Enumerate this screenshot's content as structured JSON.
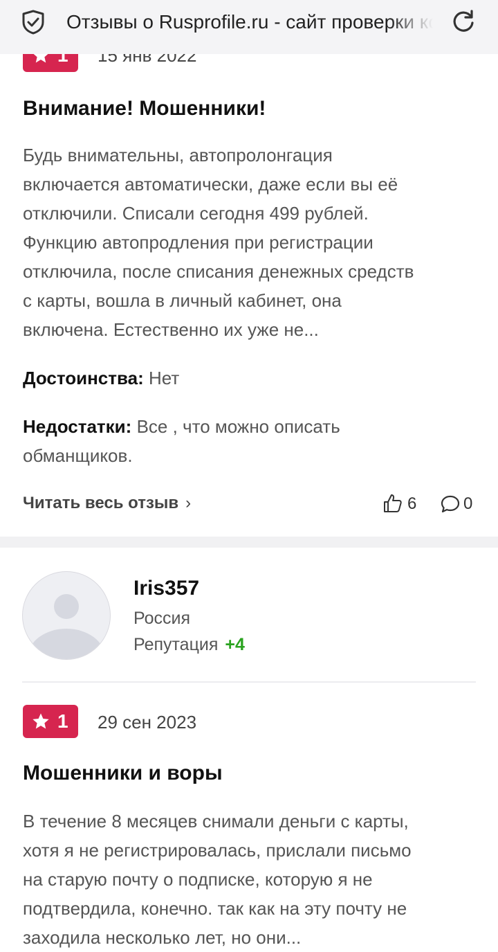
{
  "header": {
    "page_title": "Отзывы о Rusprofile.ru - сайт проверки контрагентов",
    "icons": {
      "security": "shield-check-icon",
      "reload": "reload-icon"
    }
  },
  "colors": {
    "badge": "#d6254f",
    "reputation_positive": "#2aa31f",
    "header_bg": "#f4f4f6"
  },
  "review1": {
    "rating": "1",
    "date": "15 янв 2022",
    "title": "Внимание! Мошенники!",
    "text_lines": [
      "Будь внимательны, автопролонгация",
      "включается автоматически, даже если вы её",
      "отключили. Списали сегодня 499 рублей.",
      "Функцию автопродления при регистрации",
      "отключила, после списания денежных средств",
      "с карты, вошла в личный кабинет, она",
      "включена. Естественно их уже не..."
    ],
    "pros_label": "Достоинства:",
    "pros_value": "Нет",
    "cons_label": "Недостатки:",
    "cons_line1": "Все , что можно описать",
    "cons_line2": "обманщиков.",
    "read_more": "Читать весь отзыв",
    "read_more_chevron": "›",
    "likes": "6",
    "comments": "0"
  },
  "author2": {
    "username": "Iris357",
    "country": "Россия",
    "reputation_label": "Репутация",
    "reputation_value": "+4"
  },
  "review2": {
    "rating": "1",
    "date": "29 сен 2023",
    "title": "Мошенники и воры",
    "text_lines": [
      "В течение 8 месяцев снимали деньги с карты,",
      "хотя я не регистрировалась, прислали письмо",
      "на старую почту о подписке, которую я не",
      "подтвердила, конечно. так как на эту почту не",
      "заходила несколько лет, но они..."
    ]
  }
}
